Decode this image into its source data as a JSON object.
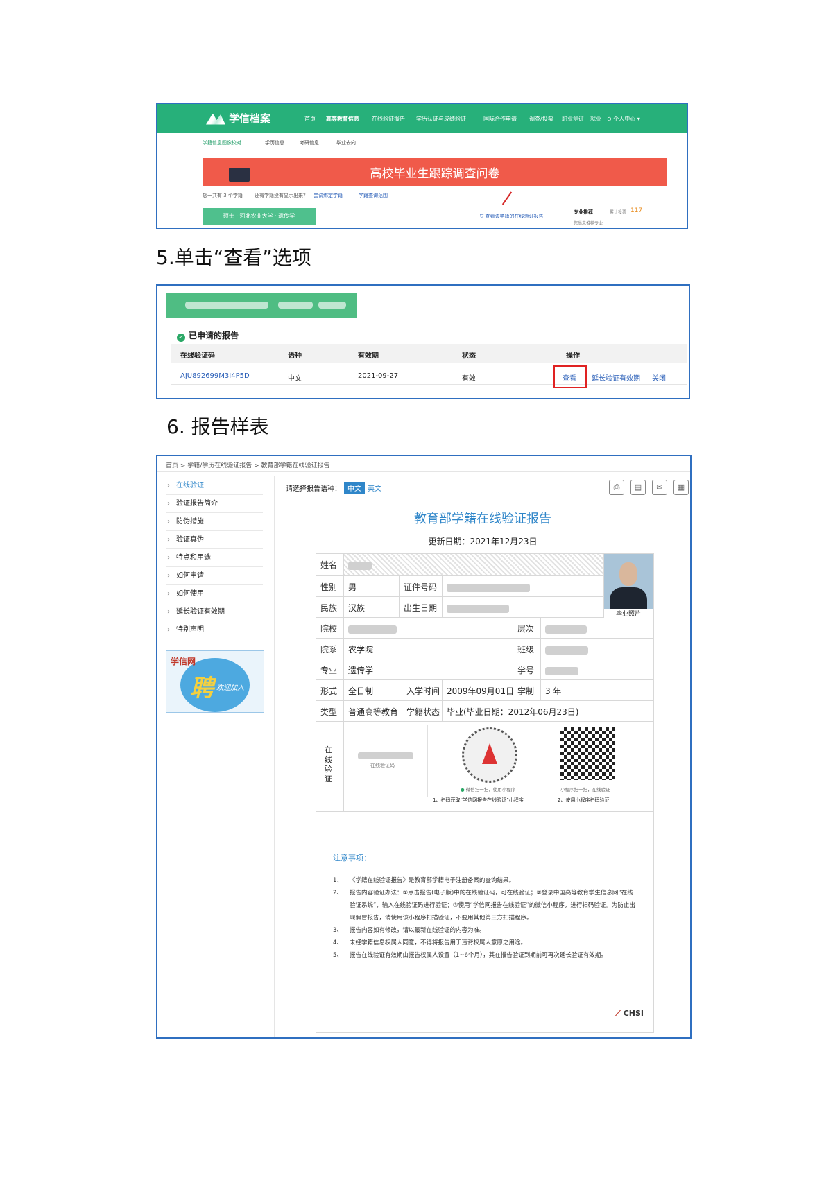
{
  "shot1": {
    "logo": "学信档案",
    "nav": [
      "首页",
      "高等教育信息",
      "在线验证报告",
      "学历认证与成绩验证",
      "国际合作申请",
      "调查/投票",
      "职业测评",
      "就业",
      "⊙ 个人中心 ▾"
    ],
    "subnav": [
      "学籍信息图像校对",
      "学历信息",
      "考研信息",
      "毕业去向"
    ],
    "banner": "高校毕业生跟踪调查问卷",
    "line_count": "您一共有 3 个学籍",
    "line_missing": "还有学籍没有显示出来？",
    "line_bind": "尝试绑定学籍",
    "line_range": "学籍查询范围",
    "record": "硕士 · 河北农业大学 · 遗传学",
    "verify_link": "查看该学籍的在线验证报告",
    "card_label": "专业推荐",
    "card_count_label": "累计投票",
    "card_count": "117",
    "card_sub": "您尚未推荐专业"
  },
  "caption5": "5.单击“查看”选项",
  "shot2": {
    "section_title": "已申请的报告",
    "headers": [
      "在线验证码",
      "语种",
      "有效期",
      "状态",
      "操作"
    ],
    "row": {
      "code": "AJU892699M3I4P5D",
      "lang": "中文",
      "expiry": "2021-09-27",
      "status": "有效"
    },
    "actions": [
      "查看",
      "延长验证有效期",
      "关闭"
    ]
  },
  "caption6": "6. 报告样表",
  "shot3": {
    "breadcrumb": "首页 > 学籍/学历在线验证报告 > 教育部学籍在线验证报告",
    "sidebar": [
      "在线验证",
      "验证报告简介",
      "防伪措施",
      "验证真伪",
      "特点和用途",
      "如何申请",
      "如何使用",
      "延长验证有效期",
      "特别声明"
    ],
    "ad_brand": "学信网",
    "ad_main": "聘",
    "ad_sub": "欢迎加入",
    "lang_label": "请选择报告语种：",
    "lang_cn": "中文",
    "lang_en": "英文",
    "title": "教育部学籍在线验证报告",
    "updated": "更新日期：2021年12月23日",
    "fields": {
      "name_label": "姓名",
      "gender_label": "性别",
      "gender": "男",
      "id_label": "证件号码",
      "ethnic_label": "民族",
      "ethnic": "汉族",
      "birth_label": "出生日期",
      "photo_label": "毕业照片",
      "school_label": "院校",
      "level_label": "层次",
      "dept_label": "院系",
      "dept": "农学院",
      "class_label": "班级",
      "major_label": "专业",
      "major": "遗传学",
      "stuno_label": "学号",
      "form_label": "形式",
      "form": "全日制",
      "enroll_label": "入学时间",
      "enroll": "2009年09月01日",
      "length_label": "学制",
      "length": "3 年",
      "type_label": "类型",
      "type": "普通高等教育",
      "status_label": "学籍状态",
      "status": "毕业(毕业日期：2012年06月23日)",
      "online_label": "在线验证"
    },
    "verify_code_label": "在线验证码",
    "wechat_hint": "微信扫一扫，使用小程序",
    "miniapp_hint": "小程序扫一扫，在线验证",
    "step1": "1、扫码获取“学信网报告在线验证”小程序",
    "step2": "2、使用小程序扫码验证",
    "notes_title": "注意事项：",
    "notes": [
      "《学籍在线验证报告》是教育部学籍电子注册备案的查询结果。",
      "报告内容验证办法：①点击报告(电子版)中的在线验证码，可在线验证；②登录中国高等教育学生信息网“在线验证系统”，输入在线验证码进行验证；③使用“学信网报告在线验证”的微信小程序，进行扫码验证。为防止出现假冒报告，请使用该小程序扫描验证，不要用其他第三方扫描程序。",
      "报告内容如有修改，请以最新在线验证的内容为准。",
      "未经学籍信息权属人同意，不得将报告用于违背权属人意愿之用途。",
      "报告在线验证有效期由报告权属人设置（1~6个月），其在报告验证到期前可再次延长验证有效期。"
    ],
    "chsi": "CHSI"
  }
}
